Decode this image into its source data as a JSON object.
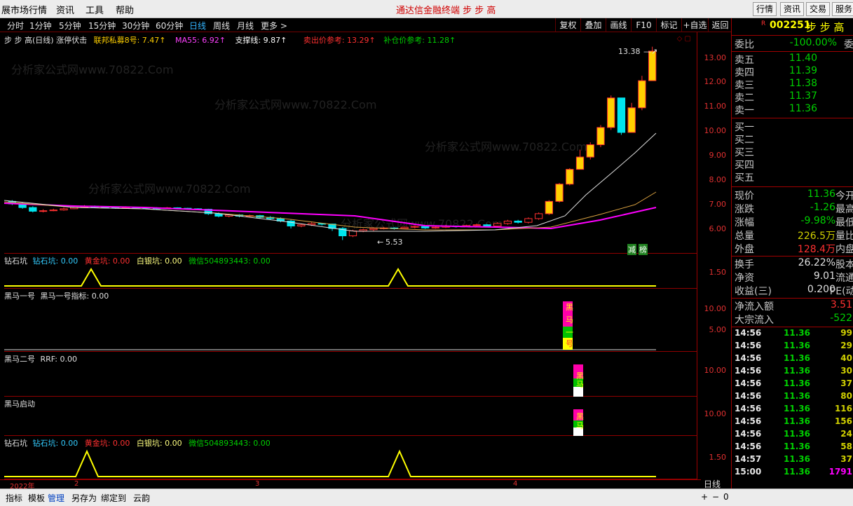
{
  "menubar": {
    "items": [
      "展市场行情",
      "资讯",
      "工具",
      "帮助"
    ],
    "title": "通达信金融终端  步 步 高",
    "right_buttons": [
      "行情",
      "资讯",
      "交易",
      "服务"
    ]
  },
  "toolbar": {
    "periods": [
      "分时",
      "1分钟",
      "5分钟",
      "15分钟",
      "30分钟",
      "60分钟",
      "日线",
      "周线",
      "月线",
      "更多 >"
    ],
    "active": "日线",
    "buttons": [
      "复权",
      "叠加",
      "画线",
      "F10",
      "标记",
      "+自选",
      "返回"
    ]
  },
  "main_pane": {
    "name": "步 步 高(日线) 涨停伏击",
    "fund": "联邦私募8号: 7.47↑",
    "ma55": "MA55: 6.92↑",
    "support": "支撑线: 9.87↑",
    "sell_ref": "卖出价参考: 13.29↑",
    "buy_ref": "补仓价参考: 11.28↑",
    "high_label": "13.38",
    "low_label": "5.53",
    "badges": [
      "减",
      "榜"
    ],
    "yticks": [
      "13.00",
      "12.00",
      "11.00",
      "10.00",
      "9.00",
      "8.00",
      "7.00",
      "6.00"
    ]
  },
  "pane1": {
    "title": "钻石坑",
    "items": [
      "钻石坑: 0.00",
      "黄金坑: 0.00",
      "白银坑: 0.00",
      "微信504893443: 0.00"
    ],
    "ytick": "1.50"
  },
  "pane2": {
    "title": "黑马一号",
    "items": [
      "黑马一号指标: 0.00"
    ],
    "yticks": [
      "10.00",
      "5.00"
    ],
    "chars": [
      "黑",
      "马",
      "一",
      "号"
    ]
  },
  "pane3": {
    "title": "黑马二号",
    "items": [
      "RRF: 0.00"
    ],
    "ytick": "10.00",
    "chars": [
      "黑",
      "马",
      "二",
      "号"
    ]
  },
  "pane4": {
    "title": "黑马启动",
    "ytick": "10.00",
    "chars": [
      "黑",
      "马",
      "启",
      "动"
    ]
  },
  "pane5": {
    "title": "钻石坑",
    "items": [
      "钻石坑: 0.00",
      "黄金坑: 0.00",
      "白银坑: 0.00",
      "微信504893443: 0.00"
    ],
    "ytick": "1.50"
  },
  "xaxis": {
    "labels": [
      "2022年",
      "2",
      "3",
      "4"
    ],
    "period": "日线"
  },
  "bottombar": {
    "tabs": [
      "指标",
      "模板",
      "管理",
      "另存为",
      "绑定到",
      "云韵"
    ],
    "active": "管理",
    "zoom": [
      "+",
      "−",
      "0"
    ]
  },
  "watermark": "分析家公式网www.70822.Com",
  "quote": {
    "code": "002251",
    "name": "步 步 高",
    "flag": "R",
    "weibi": {
      "label": "委比",
      "value": "-100.00%",
      "label2": "委差"
    },
    "asks": [
      {
        "label": "卖五",
        "price": "11.40"
      },
      {
        "label": "卖四",
        "price": "11.39"
      },
      {
        "label": "卖三",
        "price": "11.38"
      },
      {
        "label": "卖二",
        "price": "11.37"
      },
      {
        "label": "卖一",
        "price": "11.36"
      }
    ],
    "bids": [
      {
        "label": "买一"
      },
      {
        "label": "买二"
      },
      {
        "label": "买三"
      },
      {
        "label": "买四"
      },
      {
        "label": "买五"
      }
    ],
    "stats": [
      {
        "l": "现价",
        "v": "11.36",
        "l2": "今开"
      },
      {
        "l": "涨跌",
        "v": "-1.26",
        "l2": "最高"
      },
      {
        "l": "涨幅",
        "v": "-9.98%",
        "l2": "最低"
      },
      {
        "l": "总量",
        "v": "226.5万",
        "l2": "量比"
      },
      {
        "l": "外盘",
        "v": "128.4万",
        "l2": "内盘"
      }
    ],
    "stats2": [
      {
        "l": "换手",
        "v": "26.22%",
        "l2": "股本"
      },
      {
        "l": "净资",
        "v": "9.01",
        "l2": "流通"
      },
      {
        "l": "收益(三)",
        "v": "0.200",
        "l2": "PE(动)"
      }
    ],
    "flow": [
      {
        "l": "净流入额",
        "v": "3.51"
      },
      {
        "l": "大宗流入",
        "v": "-522"
      }
    ],
    "ticks": [
      {
        "t": "14:56",
        "p": "11.36",
        "v": "99"
      },
      {
        "t": "14:56",
        "p": "11.36",
        "v": "29"
      },
      {
        "t": "14:56",
        "p": "11.36",
        "v": "40"
      },
      {
        "t": "14:56",
        "p": "11.36",
        "v": "30"
      },
      {
        "t": "14:56",
        "p": "11.36",
        "v": "37"
      },
      {
        "t": "14:56",
        "p": "11.36",
        "v": "80"
      },
      {
        "t": "14:56",
        "p": "11.36",
        "v": "116"
      },
      {
        "t": "14:56",
        "p": "11.36",
        "v": "156"
      },
      {
        "t": "14:56",
        "p": "11.36",
        "v": "24"
      },
      {
        "t": "14:56",
        "p": "11.36",
        "v": "58"
      },
      {
        "t": "14:57",
        "p": "11.36",
        "v": "37"
      },
      {
        "t": "15:00",
        "p": "11.36",
        "v": "1791"
      }
    ]
  },
  "colors": {
    "up": "#ff3030",
    "down": "#00e5ee",
    "ma_magenta": "#ff00ff",
    "yellow": "#ffff00",
    "green": "#00d000"
  }
}
